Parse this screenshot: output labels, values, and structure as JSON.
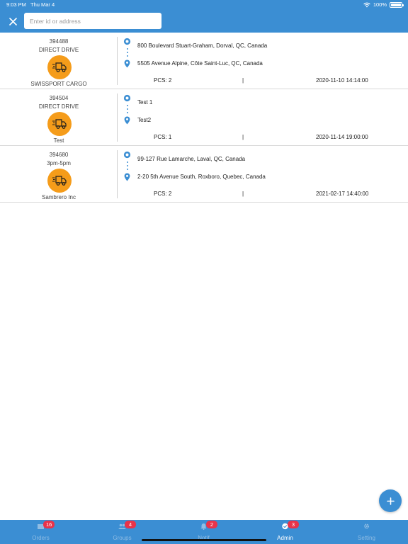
{
  "status_bar": {
    "time": "9:03 PM",
    "date": "Thu Mar 4",
    "battery": "100%"
  },
  "header": {
    "search_placeholder": "Enter id or address",
    "accent_color": "#3b8ed3"
  },
  "orders": [
    {
      "id": "394488",
      "subtitle": "DIRECT DRIVE",
      "customer": "SWISSPORT CARGO",
      "pickup": "800 Boulevard Stuart-Graham, Dorval, QC, Canada",
      "dropoff": "5505 Avenue Alpine, Côte Saint-Luc, QC, Canada",
      "pcs": "PCS: 2",
      "separator": "|",
      "datetime": "2020-11-10 14:14:00"
    },
    {
      "id": "394504",
      "subtitle": "DIRECT DRIVE",
      "customer": "Test",
      "pickup": "Test 1",
      "dropoff": "Test2",
      "pcs": "PCS: 1",
      "separator": "|",
      "datetime": "2020-11-14 19:00:00"
    },
    {
      "id": "394680",
      "subtitle": "3pm-5pm",
      "customer": "Sambrero Inc",
      "pickup": "99-127 Rue Lamarche, Laval, QC, Canada",
      "dropoff": "2-20 5th Avenue South, Roxboro, Quebec, Canada",
      "pcs": "PCS: 2",
      "separator": "|",
      "datetime": "2021-02-17 14:40:00"
    }
  ],
  "tabs": [
    {
      "label": "Orders",
      "badge": "16",
      "icon": "orders-icon"
    },
    {
      "label": "Groups",
      "badge": "4",
      "icon": "groups-icon"
    },
    {
      "label": "Notif",
      "badge": "2",
      "icon": "bell-icon"
    },
    {
      "label": "Admin",
      "badge": "3",
      "icon": "admin-icon",
      "active": true
    },
    {
      "label": "Setting",
      "badge": "",
      "icon": "gear-icon"
    }
  ],
  "colors": {
    "brand": "#3b8ed3",
    "avatar": "#f59c1a",
    "badge": "#e8334a"
  }
}
